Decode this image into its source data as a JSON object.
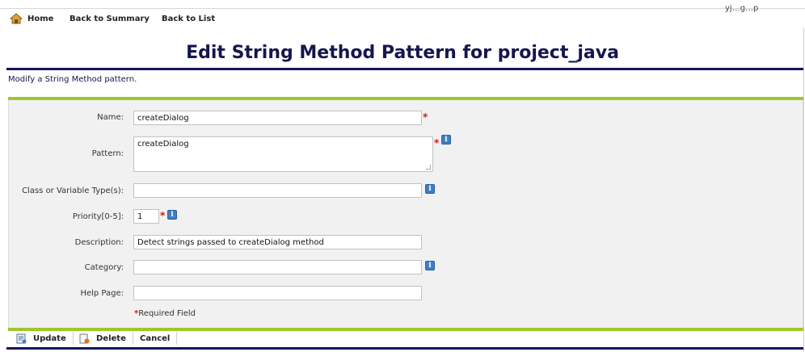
{
  "nav": {
    "home": "Home",
    "back_to_summary": "Back to Summary",
    "back_to_list": "Back to List",
    "corner_text": "yj…g…p"
  },
  "page": {
    "title": "Edit String Method Pattern for project_java",
    "subtitle": "Modify a String Method pattern."
  },
  "form": {
    "name": {
      "label": "Name:",
      "value": "createDialog"
    },
    "pattern": {
      "label": "Pattern:",
      "value": "createDialog"
    },
    "class_type": {
      "label": "Class or Variable Type(s):",
      "value": ""
    },
    "priority": {
      "label": "Priority[0-5]:",
      "value": "1"
    },
    "description": {
      "label": "Description:",
      "value": "Detect strings passed to createDialog method"
    },
    "category": {
      "label": "Category:",
      "value": ""
    },
    "help_page": {
      "label": "Help Page:",
      "value": ""
    },
    "required_star": "*",
    "required_note": "Required Field"
  },
  "actions": {
    "update": "Update",
    "delete": "Delete",
    "cancel": "Cancel"
  },
  "icons": {
    "home": "home-icon",
    "info": "info-icon",
    "update": "update-icon",
    "delete": "delete-icon"
  },
  "colors": {
    "navy": "#15165a",
    "green": "#9dc72c",
    "required": "#d11a1a",
    "info_blue": "#3e7fc4",
    "panel_bg": "#f1f1f1"
  }
}
